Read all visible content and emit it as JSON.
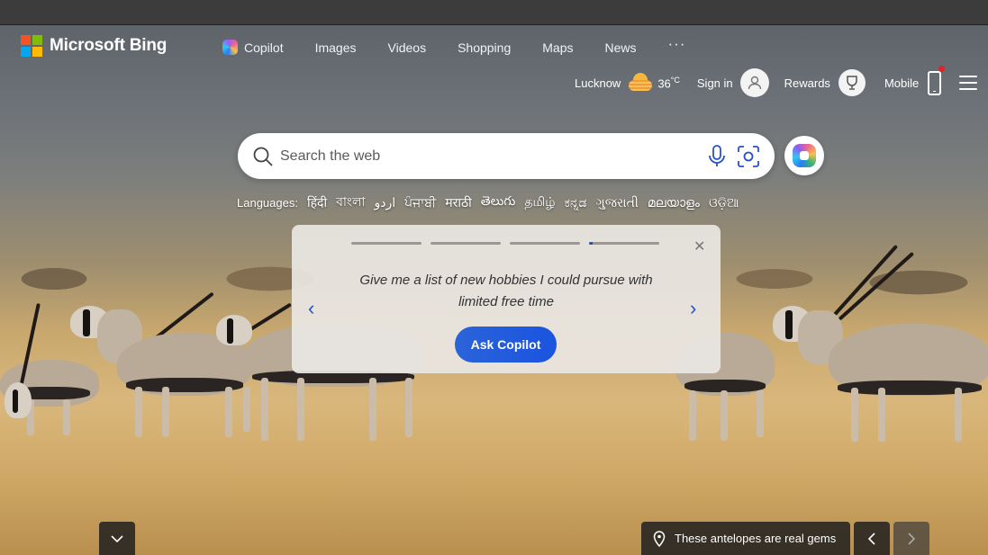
{
  "brand": {
    "name": "Microsoft Bing",
    "logo_colors": [
      "#f35325",
      "#81bc06",
      "#05a6f0",
      "#ffba08"
    ]
  },
  "nav": {
    "items": [
      {
        "label": "Copilot",
        "icon": "copilot-icon"
      },
      {
        "label": "Images"
      },
      {
        "label": "Videos"
      },
      {
        "label": "Shopping"
      },
      {
        "label": "Maps"
      },
      {
        "label": "News"
      }
    ],
    "more": "···"
  },
  "header": {
    "location": "Lucknow",
    "temperature": "36",
    "temp_unit": "°C",
    "sign_in": "Sign in",
    "rewards": "Rewards",
    "mobile": "Mobile"
  },
  "search": {
    "placeholder": "Search the web"
  },
  "languages": {
    "label": "Languages:",
    "items": [
      "हिंदी",
      "বাংলা",
      "اردو",
      "ਪੰਜਾਬੀ",
      "मराठी",
      "తెలుగు",
      "தமிழ்",
      "ಕನ್ನಡ",
      "ગુજરાતી",
      "മലയാളം",
      "ଓଡ଼ିଆ"
    ]
  },
  "prompt_card": {
    "text": "Give me a list of new hobbies I could pursue with limited free time",
    "button": "Ask Copilot",
    "progress_segments": 4,
    "current_segment_progress": 0.05
  },
  "footer": {
    "caption": "These antelopes are real gems"
  },
  "colors": {
    "accent": "#1a54e0",
    "notification": "#e3202c"
  }
}
